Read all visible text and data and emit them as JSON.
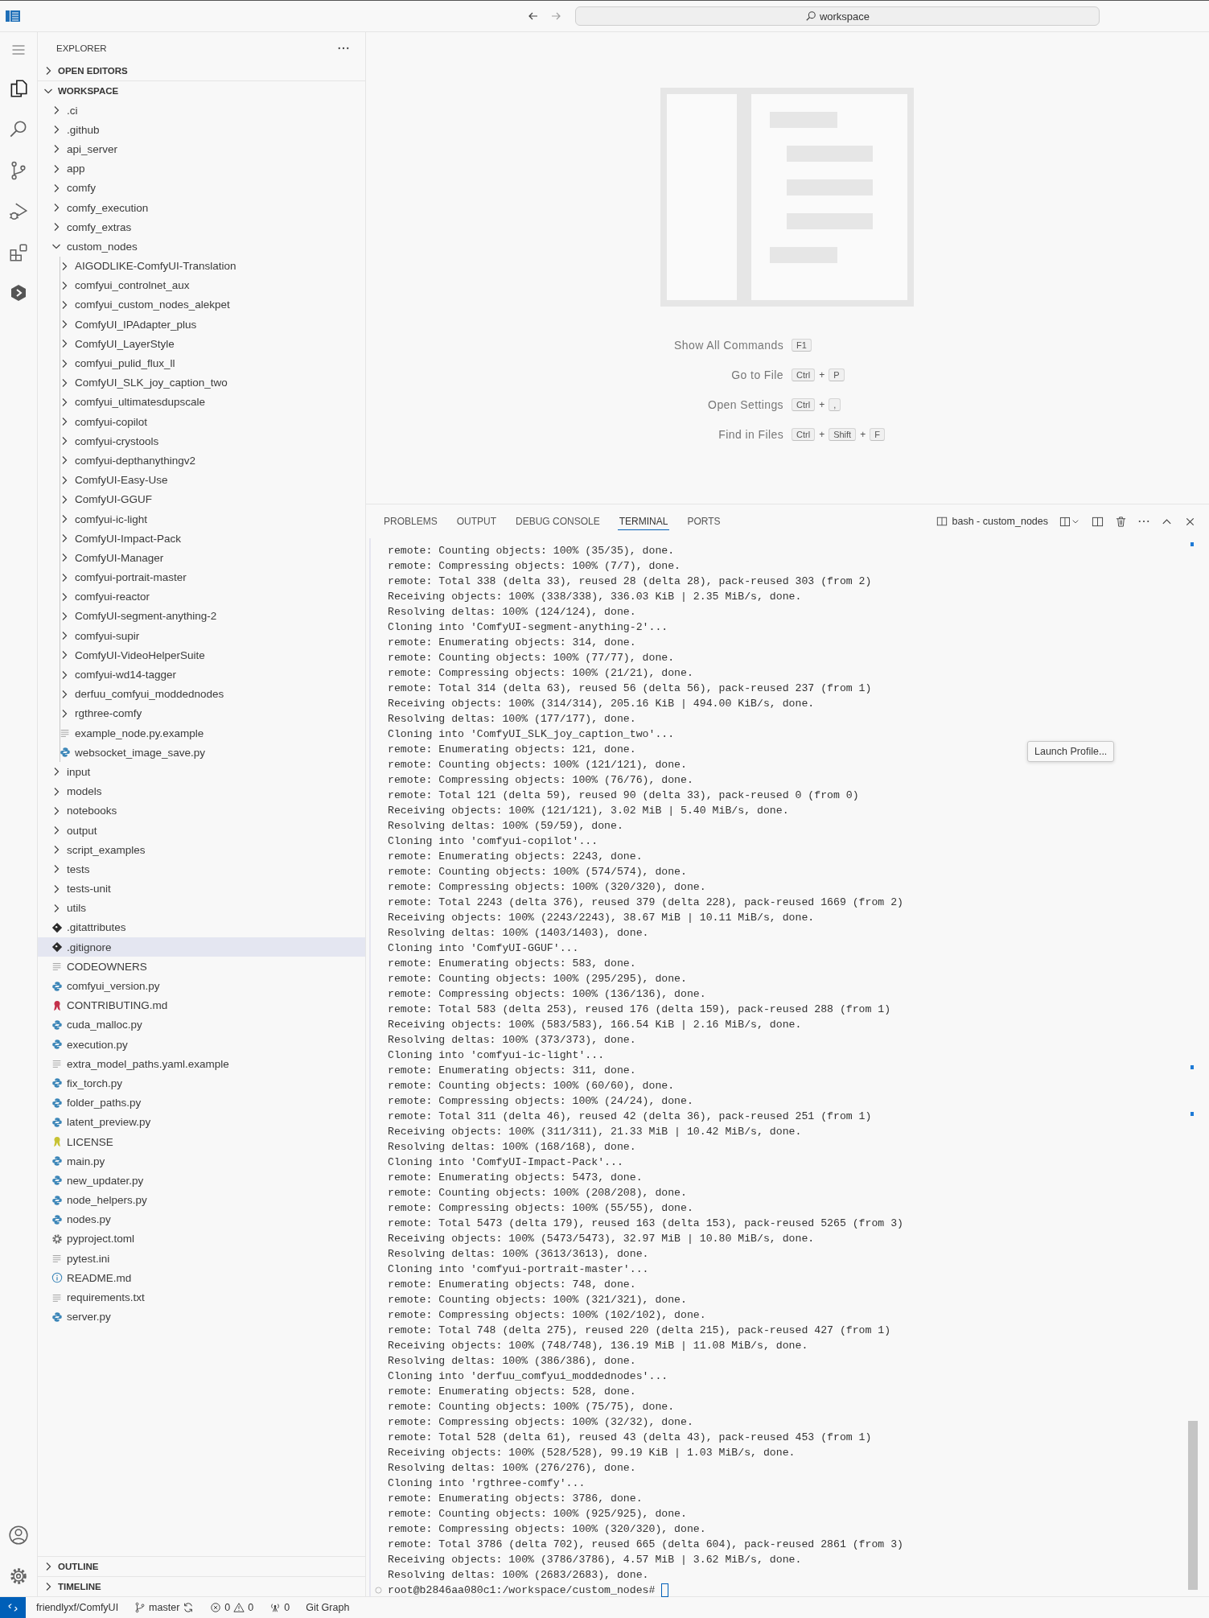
{
  "title_bar": {
    "search": "workspace"
  },
  "explorer": {
    "title": "EXPLORER",
    "sections": [
      {
        "label": "OPEN EDITORS",
        "expanded": false
      },
      {
        "label": "WORKSPACE",
        "expanded": true
      }
    ],
    "tree": [
      {
        "name": ".ci",
        "kind": "folder",
        "expanded": false,
        "selected": false
      },
      {
        "name": ".github",
        "kind": "folder",
        "expanded": false,
        "selected": false
      },
      {
        "name": "api_server",
        "kind": "folder",
        "expanded": false,
        "selected": false
      },
      {
        "name": "app",
        "kind": "folder",
        "expanded": false,
        "selected": false
      },
      {
        "name": "comfy",
        "kind": "folder",
        "expanded": false,
        "selected": false
      },
      {
        "name": "comfy_execution",
        "kind": "folder",
        "expanded": false,
        "selected": false
      },
      {
        "name": "comfy_extras",
        "kind": "folder",
        "expanded": false,
        "selected": false
      },
      {
        "name": "custom_nodes",
        "kind": "folder",
        "expanded": true,
        "selected": false,
        "children": [
          {
            "name": "AIGODLIKE-ComfyUI-Translation",
            "kind": "folder",
            "expanded": false,
            "selected": false
          },
          {
            "name": "comfyui_controlnet_aux",
            "kind": "folder",
            "expanded": false,
            "selected": false
          },
          {
            "name": "comfyui_custom_nodes_alekpet",
            "kind": "folder",
            "expanded": false,
            "selected": false
          },
          {
            "name": "ComfyUI_IPAdapter_plus",
            "kind": "folder",
            "expanded": false,
            "selected": false
          },
          {
            "name": "ComfyUI_LayerStyle",
            "kind": "folder",
            "expanded": false,
            "selected": false
          },
          {
            "name": "comfyui_pulid_flux_ll",
            "kind": "folder",
            "expanded": false,
            "selected": false
          },
          {
            "name": "ComfyUI_SLK_joy_caption_two",
            "kind": "folder",
            "expanded": false,
            "selected": false
          },
          {
            "name": "comfyui_ultimatesdupscale",
            "kind": "folder",
            "expanded": false,
            "selected": false
          },
          {
            "name": "comfyui-copilot",
            "kind": "folder",
            "expanded": false,
            "selected": false
          },
          {
            "name": "comfyui-crystools",
            "kind": "folder",
            "expanded": false,
            "selected": false
          },
          {
            "name": "comfyui-depthanythingv2",
            "kind": "folder",
            "expanded": false,
            "selected": false
          },
          {
            "name": "ComfyUI-Easy-Use",
            "kind": "folder",
            "expanded": false,
            "selected": false
          },
          {
            "name": "ComfyUI-GGUF",
            "kind": "folder",
            "expanded": false,
            "selected": false
          },
          {
            "name": "comfyui-ic-light",
            "kind": "folder",
            "expanded": false,
            "selected": false
          },
          {
            "name": "ComfyUI-Impact-Pack",
            "kind": "folder",
            "expanded": false,
            "selected": false
          },
          {
            "name": "ComfyUI-Manager",
            "kind": "folder",
            "expanded": false,
            "selected": false
          },
          {
            "name": "comfyui-portrait-master",
            "kind": "folder",
            "expanded": false,
            "selected": false
          },
          {
            "name": "comfyui-reactor",
            "kind": "folder",
            "expanded": false,
            "selected": false
          },
          {
            "name": "ComfyUI-segment-anything-2",
            "kind": "folder",
            "expanded": false,
            "selected": false
          },
          {
            "name": "comfyui-supir",
            "kind": "folder",
            "expanded": false,
            "selected": false
          },
          {
            "name": "ComfyUI-VideoHelperSuite",
            "kind": "folder",
            "expanded": false,
            "selected": false
          },
          {
            "name": "comfyui-wd14-tagger",
            "kind": "folder",
            "expanded": false,
            "selected": false
          },
          {
            "name": "derfuu_comfyui_moddednodes",
            "kind": "folder",
            "expanded": false,
            "selected": false
          },
          {
            "name": "rgthree-comfy",
            "kind": "folder",
            "expanded": false,
            "selected": false
          },
          {
            "name": "example_node.py.example",
            "kind": "text",
            "selected": false
          },
          {
            "name": "websocket_image_save.py",
            "kind": "python",
            "selected": false
          }
        ]
      },
      {
        "name": "input",
        "kind": "folder",
        "expanded": false,
        "selected": false
      },
      {
        "name": "models",
        "kind": "folder",
        "expanded": false,
        "selected": false
      },
      {
        "name": "notebooks",
        "kind": "folder",
        "expanded": false,
        "selected": false
      },
      {
        "name": "output",
        "kind": "folder",
        "expanded": false,
        "selected": false
      },
      {
        "name": "script_examples",
        "kind": "folder",
        "expanded": false,
        "selected": false
      },
      {
        "name": "tests",
        "kind": "folder",
        "expanded": false,
        "selected": false
      },
      {
        "name": "tests-unit",
        "kind": "folder",
        "expanded": false,
        "selected": false
      },
      {
        "name": "utils",
        "kind": "folder",
        "expanded": false,
        "selected": false
      },
      {
        "name": ".gitattributes",
        "kind": "git",
        "selected": false
      },
      {
        "name": ".gitignore",
        "kind": "git",
        "selected": true
      },
      {
        "name": "CODEOWNERS",
        "kind": "text",
        "selected": false
      },
      {
        "name": "comfyui_version.py",
        "kind": "python",
        "selected": false
      },
      {
        "name": "CONTRIBUTING.md",
        "kind": "ribbon",
        "color": "#c4314b",
        "selected": false
      },
      {
        "name": "cuda_malloc.py",
        "kind": "python",
        "selected": false
      },
      {
        "name": "execution.py",
        "kind": "python",
        "selected": false
      },
      {
        "name": "extra_model_paths.yaml.example",
        "kind": "text",
        "selected": false
      },
      {
        "name": "fix_torch.py",
        "kind": "python",
        "selected": false
      },
      {
        "name": "folder_paths.py",
        "kind": "python",
        "selected": false
      },
      {
        "name": "latent_preview.py",
        "kind": "python",
        "selected": false
      },
      {
        "name": "LICENSE",
        "kind": "ribbon",
        "color": "#c7c233",
        "selected": false
      },
      {
        "name": "main.py",
        "kind": "python",
        "selected": false
      },
      {
        "name": "new_updater.py",
        "kind": "python",
        "selected": false
      },
      {
        "name": "node_helpers.py",
        "kind": "python",
        "selected": false
      },
      {
        "name": "nodes.py",
        "kind": "python",
        "selected": false
      },
      {
        "name": "pyproject.toml",
        "kind": "config",
        "selected": false
      },
      {
        "name": "pytest.ini",
        "kind": "text",
        "selected": false
      },
      {
        "name": "README.md",
        "kind": "info",
        "selected": false
      },
      {
        "name": "requirements.txt",
        "kind": "text",
        "selected": false
      },
      {
        "name": "server.py",
        "kind": "python",
        "selected": false
      }
    ],
    "bottom_sections": [
      {
        "label": "OUTLINE",
        "expanded": false
      },
      {
        "label": "TIMELINE",
        "expanded": false
      }
    ]
  },
  "editor": {
    "key_separator": "+",
    "shortcuts": [
      {
        "label": "Show All Commands",
        "keys": [
          "F1"
        ]
      },
      {
        "label": "Go to File",
        "keys": [
          "Ctrl",
          "P"
        ]
      },
      {
        "label": "Open Settings",
        "keys": [
          "Ctrl",
          ","
        ]
      },
      {
        "label": "Find in Files",
        "keys": [
          "Ctrl",
          "Shift",
          "F"
        ]
      }
    ]
  },
  "panel": {
    "tabs": [
      {
        "label": "PROBLEMS",
        "selected": false
      },
      {
        "label": "OUTPUT",
        "selected": false
      },
      {
        "label": "DEBUG CONSOLE",
        "selected": false
      },
      {
        "label": "TERMINAL",
        "selected": true
      },
      {
        "label": "PORTS",
        "selected": false
      }
    ],
    "terminal_name": "bash - custom_nodes",
    "tooltip": "Launch Profile...",
    "lines": [
      "remote: Counting objects: 100% (35/35), done.",
      "remote: Compressing objects: 100% (7/7), done.",
      "remote: Total 338 (delta 33), reused 28 (delta 28), pack-reused 303 (from 2)",
      "Receiving objects: 100% (338/338), 336.03 KiB | 2.35 MiB/s, done.",
      "Resolving deltas: 100% (124/124), done.",
      "Cloning into 'ComfyUI-segment-anything-2'...",
      "remote: Enumerating objects: 314, done.",
      "remote: Counting objects: 100% (77/77), done.",
      "remote: Compressing objects: 100% (21/21), done.",
      "remote: Total 314 (delta 63), reused 56 (delta 56), pack-reused 237 (from 1)",
      "Receiving objects: 100% (314/314), 205.16 KiB | 494.00 KiB/s, done.",
      "Resolving deltas: 100% (177/177), done.",
      "Cloning into 'ComfyUI_SLK_joy_caption_two'...",
      "remote: Enumerating objects: 121, done.",
      "remote: Counting objects: 100% (121/121), done.",
      "remote: Compressing objects: 100% (76/76), done.",
      "remote: Total 121 (delta 59), reused 90 (delta 33), pack-reused 0 (from 0)",
      "Receiving objects: 100% (121/121), 3.02 MiB | 5.40 MiB/s, done.",
      "Resolving deltas: 100% (59/59), done.",
      "Cloning into 'comfyui-copilot'...",
      "remote: Enumerating objects: 2243, done.",
      "remote: Counting objects: 100% (574/574), done.",
      "remote: Compressing objects: 100% (320/320), done.",
      "remote: Total 2243 (delta 376), reused 379 (delta 228), pack-reused 1669 (from 2)",
      "Receiving objects: 100% (2243/2243), 38.67 MiB | 10.11 MiB/s, done.",
      "Resolving deltas: 100% (1403/1403), done.",
      "Cloning into 'ComfyUI-GGUF'...",
      "remote: Enumerating objects: 583, done.",
      "remote: Counting objects: 100% (295/295), done.",
      "remote: Compressing objects: 100% (136/136), done.",
      "remote: Total 583 (delta 253), reused 176 (delta 159), pack-reused 288 (from 1)",
      "Receiving objects: 100% (583/583), 166.54 KiB | 2.16 MiB/s, done.",
      "Resolving deltas: 100% (373/373), done.",
      "Cloning into 'comfyui-ic-light'...",
      "remote: Enumerating objects: 311, done.",
      "remote: Counting objects: 100% (60/60), done.",
      "remote: Compressing objects: 100% (24/24), done.",
      "remote: Total 311 (delta 46), reused 42 (delta 36), pack-reused 251 (from 1)",
      "Receiving objects: 100% (311/311), 21.33 MiB | 10.42 MiB/s, done.",
      "Resolving deltas: 100% (168/168), done.",
      "Cloning into 'ComfyUI-Impact-Pack'...",
      "remote: Enumerating objects: 5473, done.",
      "remote: Counting objects: 100% (208/208), done.",
      "remote: Compressing objects: 100% (55/55), done.",
      "remote: Total 5473 (delta 179), reused 163 (delta 153), pack-reused 5265 (from 3)",
      "Receiving objects: 100% (5473/5473), 32.97 MiB | 10.80 MiB/s, done.",
      "Resolving deltas: 100% (3613/3613), done.",
      "Cloning into 'comfyui-portrait-master'...",
      "remote: Enumerating objects: 748, done.",
      "remote: Counting objects: 100% (321/321), done.",
      "remote: Compressing objects: 100% (102/102), done.",
      "remote: Total 748 (delta 275), reused 220 (delta 215), pack-reused 427 (from 1)",
      "Receiving objects: 100% (748/748), 136.19 MiB | 11.08 MiB/s, done.",
      "Resolving deltas: 100% (386/386), done.",
      "Cloning into 'derfuu_comfyui_moddednodes'...",
      "remote: Enumerating objects: 528, done.",
      "remote: Counting objects: 100% (75/75), done.",
      "remote: Compressing objects: 100% (32/32), done.",
      "remote: Total 528 (delta 61), reused 43 (delta 43), pack-reused 453 (from 1)",
      "Receiving objects: 100% (528/528), 99.19 KiB | 1.03 MiB/s, done.",
      "Resolving deltas: 100% (276/276), done.",
      "Cloning into 'rgthree-comfy'...",
      "remote: Enumerating objects: 3786, done.",
      "remote: Counting objects: 100% (925/925), done.",
      "remote: Compressing objects: 100% (320/320), done.",
      "remote: Total 3786 (delta 702), reused 665 (delta 604), pack-reused 2861 (from 3)",
      "Receiving objects: 100% (3786/3786), 4.57 MiB | 3.62 MiB/s, done.",
      "Resolving deltas: 100% (2683/2683), done."
    ],
    "prompt": "root@b2846aa080c1:/workspace/custom_nodes#"
  },
  "status_bar": {
    "repo": "friendlyxf/ComfyUI",
    "branch": "master",
    "errors": "0",
    "warnings": "0",
    "ports": "0",
    "git_graph": "Git Graph"
  }
}
